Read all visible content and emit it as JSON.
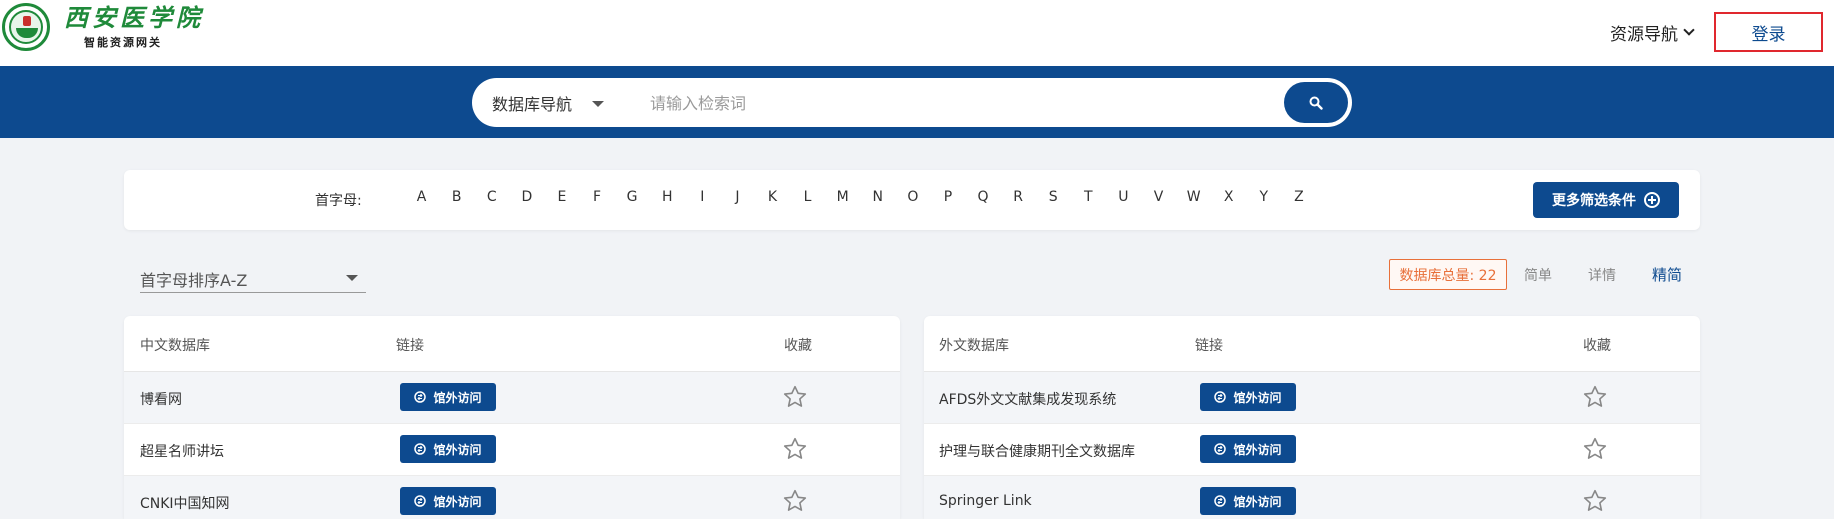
{
  "header": {
    "logo_title": "西安医学院",
    "logo_subtitle": "智能资源网关",
    "resource_nav": "资源导航",
    "login": "登录"
  },
  "search": {
    "category": "数据库导航",
    "placeholder": "请输入检索词",
    "icon": "search-icon"
  },
  "filter": {
    "letter_label": "首字母:",
    "letters": [
      "A",
      "B",
      "C",
      "D",
      "E",
      "F",
      "G",
      "H",
      "I",
      "J",
      "K",
      "L",
      "M",
      "N",
      "O",
      "P",
      "Q",
      "R",
      "S",
      "T",
      "U",
      "V",
      "W",
      "X",
      "Y",
      "Z"
    ],
    "more_filter": "更多筛选条件"
  },
  "sort": {
    "selected": "首字母排序A-Z"
  },
  "view": {
    "total": "数据库总量: 22",
    "tabs": [
      "简单",
      "详情",
      "精简"
    ],
    "active_tab": "精简"
  },
  "tables": [
    {
      "headers": [
        "中文数据库",
        "链接",
        "收藏"
      ],
      "rows": [
        {
          "name": "博看网",
          "link": "馆外访问"
        },
        {
          "name": "超星名师讲坛",
          "link": "馆外访问"
        },
        {
          "name": "CNKI中国知网",
          "link": "馆外访问"
        }
      ]
    },
    {
      "headers": [
        "外文数据库",
        "链接",
        "收藏"
      ],
      "rows": [
        {
          "name": "AFDS外文文献集成发现系统",
          "link": "馆外访问"
        },
        {
          "name": "护理与联合健康期刊全文数据库",
          "link": "馆外访问"
        },
        {
          "name": "Springer Link",
          "link": "馆外访问"
        }
      ]
    }
  ],
  "colors": {
    "primary": "#0d4a8f",
    "accent_orange": "#e8703a",
    "login_border": "#e0282e",
    "logo_green": "#1f8a3a"
  }
}
